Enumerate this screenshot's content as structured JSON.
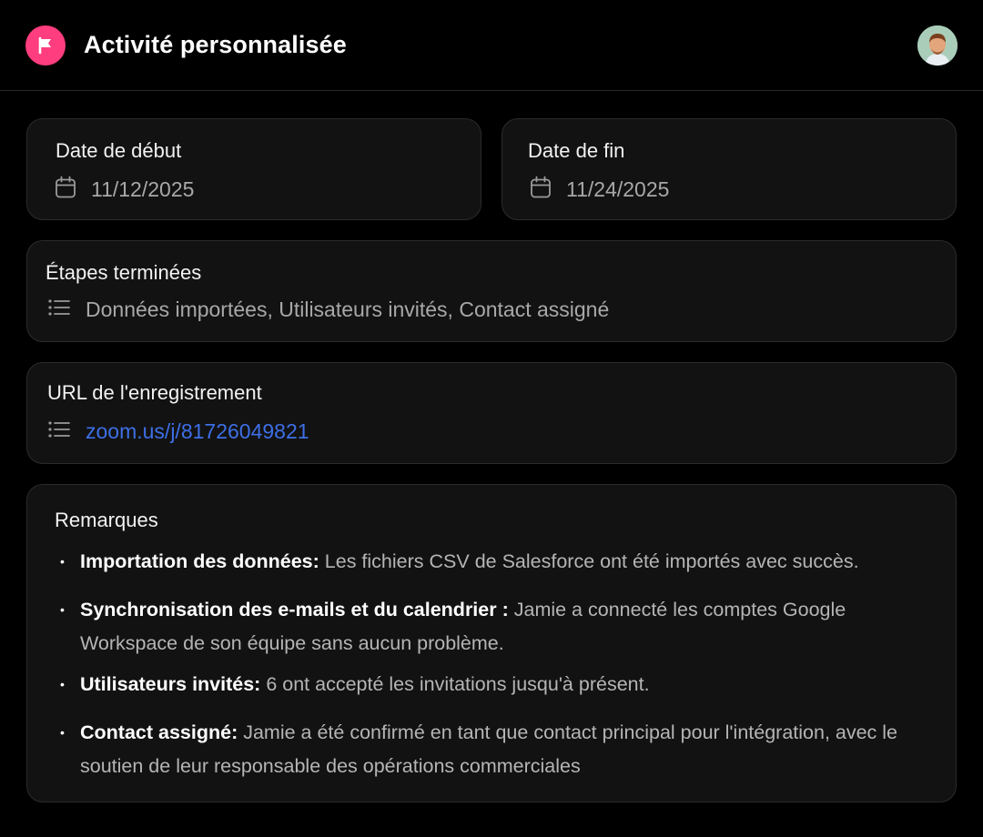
{
  "header": {
    "title": "Activité personnalisée",
    "icon": "flag-icon",
    "accent_color": "#ff3d7f"
  },
  "start_date": {
    "label": "Date de début",
    "value": "11/12/2025",
    "icon": "calendar-icon"
  },
  "end_date": {
    "label": "Date de fin",
    "value": "11/24/2025",
    "icon": "calendar-icon"
  },
  "steps": {
    "label": "Étapes terminées",
    "value": "Données importées, Utilisateurs invités, Contact assigné",
    "icon": "list-icon"
  },
  "recording": {
    "label": "URL de l'enregistrement",
    "value": "zoom.us/j/81726049821",
    "icon": "list-icon",
    "link_color": "#3d6fe6"
  },
  "notes": {
    "label": "Remarques",
    "items": [
      {
        "title": "Importation des données:",
        "text": "Les fichiers CSV de Salesforce ont été importés avec succès."
      },
      {
        "title": "Synchronisation des e-mails et du calendrier :",
        "text": "Jamie a connecté les comptes Google Workspace de son équipe sans aucun problème."
      },
      {
        "title": "Utilisateurs invités:",
        "text": "6 ont accepté les invitations jusqu'à présent."
      },
      {
        "title": "Contact assigné:",
        "text": "Jamie a été confirmé en tant que contact principal pour l'intégration, avec le soutien de leur responsable des opérations commerciales"
      }
    ]
  }
}
